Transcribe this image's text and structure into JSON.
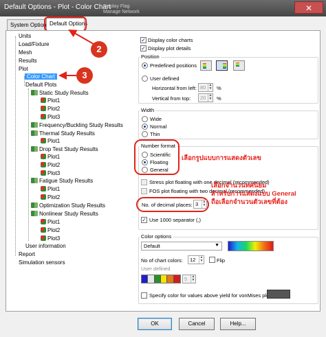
{
  "window": {
    "title": "Default Options - Plot - Color Chart",
    "bg_app_labels": [
      "Display Flag",
      "Manage Network"
    ],
    "close_glyph": "✕"
  },
  "tabs": [
    {
      "label": "System Options",
      "active": false
    },
    {
      "label": "Default Options",
      "active": true
    }
  ],
  "tree": {
    "units": "Units",
    "load_fixture": "Load/Fixture",
    "mesh": "Mesh",
    "results": "Results",
    "plot": "Plot",
    "color_chart": "Color Chart",
    "default_plots": "Default Plots",
    "static": "Static Study Results",
    "freq": "Frequency/Buckling Study Results",
    "thermal": "Thermal Study Results",
    "drop": "Drop Test Study Results",
    "fatigue": "Fatigue Study Results",
    "optimization": "Optimization Study Results",
    "nonlinear": "Nonlinear Study Results",
    "plot1": "Plot1",
    "plot2": "Plot2",
    "plot3": "Plot3",
    "user_info": "User information",
    "report": "Report",
    "sim_sensors": "Simulation sensors"
  },
  "display": {
    "display_color_charts": "Display color charts",
    "display_color_charts_checked": true,
    "display_plot_details": "Display plot details",
    "display_plot_details_checked": true
  },
  "position": {
    "title": "Position",
    "predefined": "Predefined positions",
    "user_defined": "User defined",
    "horizontal_label": "Horizontal from left:",
    "horizontal_value": "80",
    "vertical_label": "Vertical from top:",
    "vertical_value": "20",
    "percent": "%"
  },
  "width": {
    "title": "Width",
    "wide": "Wide",
    "normal": "Normal",
    "thin": "Thin",
    "selected": "Normal"
  },
  "number_format": {
    "title": "Number format",
    "scientific": "Scientific",
    "floating": "Floating",
    "general": "General",
    "selected": "Floating",
    "stress_one_decimal": "Stress plot floating with one decimal (recommended)",
    "fos_two_decimal": "FOS plot floating with two decimal (recommended)",
    "decimal_places_label": "No. of decimal places:",
    "decimal_places_value": "3",
    "use_1000_separator": "Use 1000 separator (,)",
    "use_1000_separator_checked": true
  },
  "color_options": {
    "title": "Color options",
    "scheme": "Default",
    "num_chart_colors_label": "No of chart colors:",
    "num_chart_colors_value": "12",
    "flip": "Flip",
    "user_defined": "User defined",
    "user_defined_value": "5",
    "swatch_colors": [
      "#1e1ecc",
      "#e8e8e8",
      "#2a8f2a",
      "#f2e600",
      "#e07a1a",
      "#d81a1a"
    ],
    "gradient_stops": [
      "#1e1ecc",
      "#1ab0e8",
      "#18d860",
      "#f0f000",
      "#f07018",
      "#e01818"
    ],
    "yield_label": "Specify color for values above yield for vonMises plot",
    "yield_color": "#555555"
  },
  "annotations": {
    "badge_2": "2",
    "badge_3": "3",
    "number_format_note": "เลือกรูปแบบการแสดงตัวเลข",
    "decimal_note_line1": "เลือกจำนวนทศนิยม",
    "decimal_note_line2": "สำหรับการแสดงแบบ General",
    "decimal_note_line3": "ถือเลือกจำนวนตัวเลขที่ต้อง",
    "accent": "#e0231a"
  },
  "buttons": {
    "ok": "OK",
    "cancel": "Cancel",
    "help": "Help..."
  }
}
